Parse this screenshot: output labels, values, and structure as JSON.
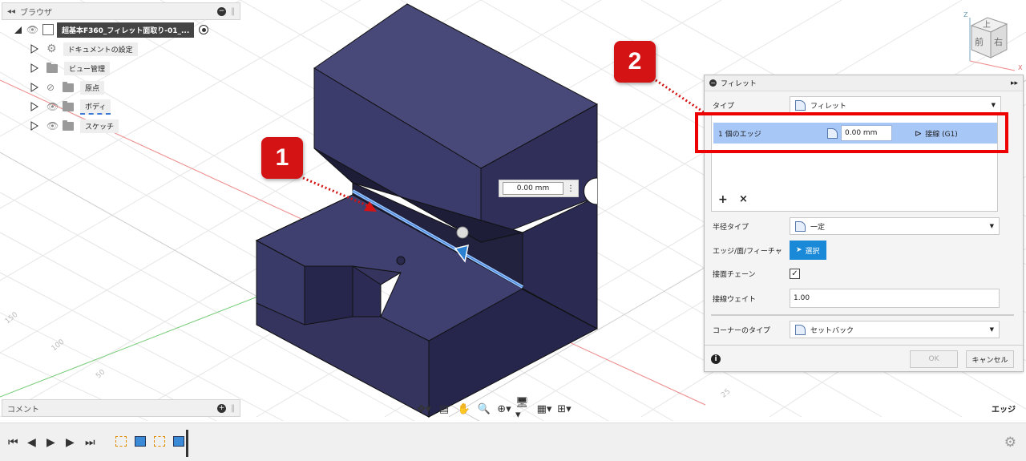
{
  "browser": {
    "title": "ブラウザ",
    "root": "超基本F360_フィレット面取り-01_...",
    "items": [
      {
        "label": "ドキュメントの設定"
      },
      {
        "label": "ビュー管理"
      },
      {
        "label": "原点"
      },
      {
        "label": "ボディ"
      },
      {
        "label": "スケッチ"
      }
    ]
  },
  "comments": {
    "title": "コメント"
  },
  "viewport": {
    "measure_value": "0.00 mm",
    "grid_labels": [
      "150",
      "100",
      "50",
      "25"
    ],
    "selection_label": "エッジ"
  },
  "viewcube": {
    "top": "上",
    "front": "前",
    "right": "右",
    "axis_z": "Z",
    "axis_x": "X"
  },
  "callouts": {
    "one": "1",
    "two": "2"
  },
  "dialog": {
    "title": "フィレット",
    "type_label": "タイプ",
    "type_value": "フィレット",
    "edge_count": "1 個のエッジ",
    "edge_value": "0.00 mm",
    "edge_tangent": "接線 (G1)",
    "radius_type_label": "半径タイプ",
    "radius_type_value": "一定",
    "selection_label": "エッジ/面/フィーチャ",
    "select_button": "選択",
    "tangent_chain_label": "接面チェーン",
    "tangent_weight_label": "接線ウェイト",
    "tangent_weight_value": "1.00",
    "corner_type_label": "コーナーのタイプ",
    "corner_type_value": "セットバック",
    "ok": "OK",
    "cancel": "キャンセル"
  }
}
